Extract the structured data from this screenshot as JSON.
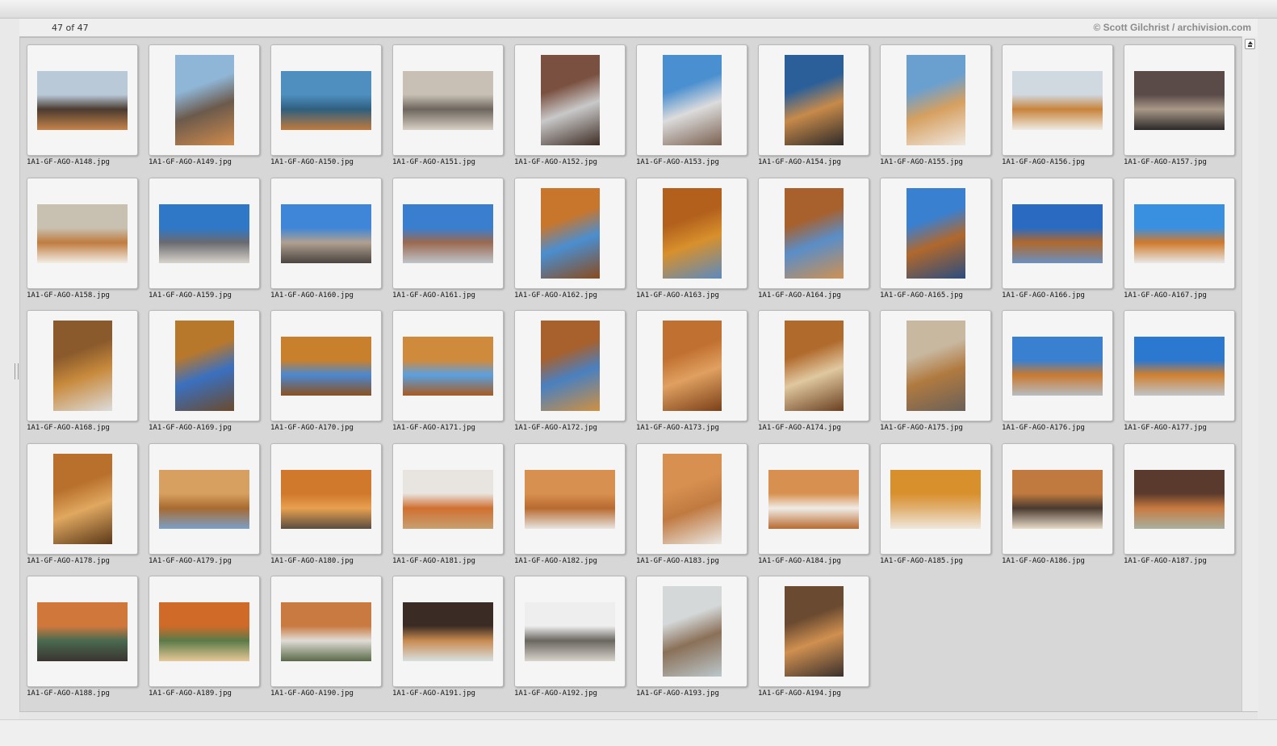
{
  "header": {
    "count": "47 of 47",
    "credit": "© Scott Gilchrist / archivision.com"
  },
  "thumbnails": [
    {
      "filename": "1A1-GF-AGO-A148.jpg",
      "orientation": "landscape",
      "colors": [
        "#b9c9d8",
        "#4a3b30",
        "#c7844a"
      ]
    },
    {
      "filename": "1A1-GF-AGO-A149.jpg",
      "orientation": "portrait",
      "colors": [
        "#8fb6d6",
        "#6b5a4c",
        "#d08b4c"
      ]
    },
    {
      "filename": "1A1-GF-AGO-A150.jpg",
      "orientation": "landscape",
      "colors": [
        "#4e8fbf",
        "#2f5f7f",
        "#c07a3c"
      ]
    },
    {
      "filename": "1A1-GF-AGO-A151.jpg",
      "orientation": "landscape",
      "colors": [
        "#c8c0b4",
        "#6d665e",
        "#d8d0c4"
      ]
    },
    {
      "filename": "1A1-GF-AGO-A152.jpg",
      "orientation": "portrait",
      "colors": [
        "#7a5040",
        "#c9c9c9",
        "#3e2c24"
      ]
    },
    {
      "filename": "1A1-GF-AGO-A153.jpg",
      "orientation": "portrait",
      "colors": [
        "#4a8fd0",
        "#dcdcdc",
        "#7a6050"
      ]
    },
    {
      "filename": "1A1-GF-AGO-A154.jpg",
      "orientation": "portrait",
      "colors": [
        "#2a5f99",
        "#c78a4a",
        "#2e2a28"
      ]
    },
    {
      "filename": "1A1-GF-AGO-A155.jpg",
      "orientation": "portrait",
      "colors": [
        "#6aa0d0",
        "#d6a060",
        "#f0e8e0"
      ]
    },
    {
      "filename": "1A1-GF-AGO-A156.jpg",
      "orientation": "landscape",
      "colors": [
        "#d0d8e0",
        "#c8843c",
        "#efeae4"
      ]
    },
    {
      "filename": "1A1-GF-AGO-A157.jpg",
      "orientation": "landscape",
      "colors": [
        "#5a4a48",
        "#a89888",
        "#2c2828"
      ]
    },
    {
      "filename": "1A1-GF-AGO-A158.jpg",
      "orientation": "landscape",
      "colors": [
        "#c8c0b0",
        "#c07c40",
        "#f2ede6"
      ]
    },
    {
      "filename": "1A1-GF-AGO-A159.jpg",
      "orientation": "landscape",
      "colors": [
        "#2f78c8",
        "#6a6a70",
        "#d8d4cc"
      ]
    },
    {
      "filename": "1A1-GF-AGO-A160.jpg",
      "orientation": "landscape",
      "colors": [
        "#3f86d8",
        "#b0a090",
        "#4a4440"
      ]
    },
    {
      "filename": "1A1-GF-AGO-A161.jpg",
      "orientation": "landscape",
      "colors": [
        "#3a7ed0",
        "#9a6a50",
        "#c0c4c8"
      ]
    },
    {
      "filename": "1A1-GF-AGO-A162.jpg",
      "orientation": "portrait",
      "colors": [
        "#c8762c",
        "#4a8ed0",
        "#8a4a1c"
      ]
    },
    {
      "filename": "1A1-GF-AGO-A163.jpg",
      "orientation": "portrait",
      "colors": [
        "#b2601c",
        "#d8902c",
        "#5a8ac0"
      ]
    },
    {
      "filename": "1A1-GF-AGO-A164.jpg",
      "orientation": "portrait",
      "colors": [
        "#a8602c",
        "#5a8ec8",
        "#d09050"
      ]
    },
    {
      "filename": "1A1-GF-AGO-A165.jpg",
      "orientation": "portrait",
      "colors": [
        "#3a80d0",
        "#b0682c",
        "#2a4c80"
      ]
    },
    {
      "filename": "1A1-GF-AGO-A166.jpg",
      "orientation": "landscape",
      "colors": [
        "#2a6ac0",
        "#b0682c",
        "#6a90c0"
      ]
    },
    {
      "filename": "1A1-GF-AGO-A167.jpg",
      "orientation": "landscape",
      "colors": [
        "#3a90e0",
        "#d07a2c",
        "#e8e8e8"
      ]
    },
    {
      "filename": "1A1-GF-AGO-A168.jpg",
      "orientation": "portrait",
      "colors": [
        "#8a5a2c",
        "#c88a3c",
        "#dcdcdc"
      ]
    },
    {
      "filename": "1A1-GF-AGO-A169.jpg",
      "orientation": "portrait",
      "colors": [
        "#b8782c",
        "#3a70c0",
        "#6a4a2c"
      ]
    },
    {
      "filename": "1A1-GF-AGO-A170.jpg",
      "orientation": "landscape",
      "colors": [
        "#c8802c",
        "#4a88d0",
        "#8a5020"
      ]
    },
    {
      "filename": "1A1-GF-AGO-A171.jpg",
      "orientation": "landscape",
      "colors": [
        "#d08a3c",
        "#5aa0e0",
        "#a85a20"
      ]
    },
    {
      "filename": "1A1-GF-AGO-A172.jpg",
      "orientation": "portrait",
      "colors": [
        "#a8602c",
        "#4a80c0",
        "#d09040"
      ]
    },
    {
      "filename": "1A1-GF-AGO-A173.jpg",
      "orientation": "portrait",
      "colors": [
        "#c07030",
        "#e0a060",
        "#7a4018"
      ]
    },
    {
      "filename": "1A1-GF-AGO-A174.jpg",
      "orientation": "portrait",
      "colors": [
        "#b06a2c",
        "#e0c8a0",
        "#6a4020"
      ]
    },
    {
      "filename": "1A1-GF-AGO-A175.jpg",
      "orientation": "portrait",
      "colors": [
        "#c8b8a0",
        "#b07a40",
        "#6a6058"
      ]
    },
    {
      "filename": "1A1-GF-AGO-A176.jpg",
      "orientation": "landscape",
      "colors": [
        "#3a80d0",
        "#c87a30",
        "#b8bcc0"
      ]
    },
    {
      "filename": "1A1-GF-AGO-A177.jpg",
      "orientation": "landscape",
      "colors": [
        "#2a78d0",
        "#d08030",
        "#c0c4c8"
      ]
    },
    {
      "filename": "1A1-GF-AGO-A178.jpg",
      "orientation": "portrait",
      "colors": [
        "#b8702c",
        "#e0a860",
        "#5a3818"
      ]
    },
    {
      "filename": "1A1-GF-AGO-A179.jpg",
      "orientation": "landscape",
      "colors": [
        "#d8a060",
        "#a86a30",
        "#7aa0c8"
      ]
    },
    {
      "filename": "1A1-GF-AGO-A180.jpg",
      "orientation": "landscape",
      "colors": [
        "#d0782c",
        "#e8a050",
        "#5a4c40"
      ]
    },
    {
      "filename": "1A1-GF-AGO-A181.jpg",
      "orientation": "landscape",
      "colors": [
        "#e8e4e0",
        "#d07030",
        "#c8a070"
      ]
    },
    {
      "filename": "1A1-GF-AGO-A182.jpg",
      "orientation": "landscape",
      "colors": [
        "#d89050",
        "#b86a30",
        "#e8e4e0"
      ]
    },
    {
      "filename": "1A1-GF-AGO-A183.jpg",
      "orientation": "portrait",
      "colors": [
        "#d89050",
        "#c07a40",
        "#eae8e4"
      ]
    },
    {
      "filename": "1A1-GF-AGO-A184.jpg",
      "orientation": "landscape",
      "colors": [
        "#d89050",
        "#f0ece6",
        "#b86a30"
      ]
    },
    {
      "filename": "1A1-GF-AGO-A185.jpg",
      "orientation": "landscape",
      "colors": [
        "#d8902c",
        "#e0b070",
        "#f0e8dc"
      ]
    },
    {
      "filename": "1A1-GF-AGO-A186.jpg",
      "orientation": "landscape",
      "colors": [
        "#c07a40",
        "#4a3a30",
        "#e8dcc8"
      ]
    },
    {
      "filename": "1A1-GF-AGO-A187.jpg",
      "orientation": "landscape",
      "colors": [
        "#5a3a2c",
        "#c87a40",
        "#a8b0a0"
      ]
    },
    {
      "filename": "1A1-GF-AGO-A188.jpg",
      "orientation": "landscape",
      "colors": [
        "#d0783c",
        "#4a6a50",
        "#3a3430"
      ]
    },
    {
      "filename": "1A1-GF-AGO-A189.jpg",
      "orientation": "landscape",
      "colors": [
        "#d06a28",
        "#5a7a48",
        "#e8c898"
      ]
    },
    {
      "filename": "1A1-GF-AGO-A190.jpg",
      "orientation": "landscape",
      "colors": [
        "#c87a40",
        "#e0dcd6",
        "#5a6a48"
      ]
    },
    {
      "filename": "1A1-GF-AGO-A191.jpg",
      "orientation": "landscape",
      "colors": [
        "#3a2c24",
        "#c88a50",
        "#d8e0e0"
      ]
    },
    {
      "filename": "1A1-GF-AGO-A192.jpg",
      "orientation": "landscape",
      "colors": [
        "#eeeeee",
        "#6a6660",
        "#d8d4cc"
      ]
    },
    {
      "filename": "1A1-GF-AGO-A193.jpg",
      "orientation": "portrait",
      "colors": [
        "#d4d8d8",
        "#8a7058",
        "#bcc8cc"
      ]
    },
    {
      "filename": "1A1-GF-AGO-A194.jpg",
      "orientation": "portrait",
      "colors": [
        "#6a4a30",
        "#d09050",
        "#3a302c"
      ]
    }
  ],
  "icons": {
    "scroll": "scroll-to-top-icon",
    "resize": "resize-handle-icon"
  }
}
